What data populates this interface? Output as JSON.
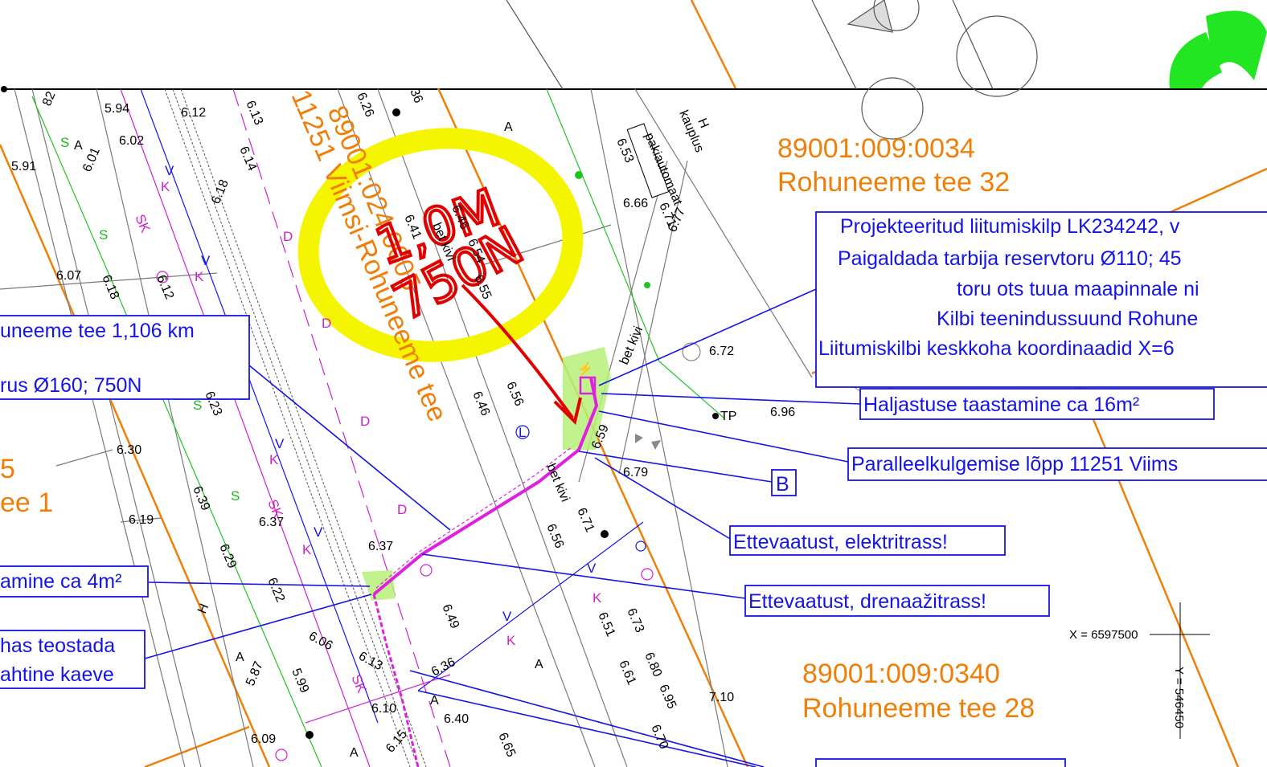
{
  "parcels": [
    {
      "id": "89001:009:0034",
      "name": "Rohuneeme tee 32"
    },
    {
      "id": "89001:009:0340",
      "name": "Rohuneeme tee 28"
    },
    {
      "id": "89001:024:0005",
      "name": "11251 Viimsi-Rohuneeme tee"
    },
    {
      "id": "5",
      "name": "ee 1"
    }
  ],
  "callouts": {
    "project_box": [
      "Projekteeritud liitumiskilp LK234242, v",
      "Paigaldada tarbija reservtoru Ø110; 45",
      "toru ots tuua maapinnale ni",
      "Kilbi teenindussuund Rohune",
      "Liitumiskilbi keskkoha koordinaadid X=6"
    ],
    "left_box_top": [
      "uneeme tee 1,106 km",
      "rus Ø160; 750N"
    ],
    "haljastus": "Haljastuse taastamine ca 16m²",
    "paralleel": "Paralleelkulgemise lõpp 11251 Viims",
    "b_label": "B",
    "elektritrass": "Ettevaatust, elektritrass!",
    "drenaaz": "Ettevaatust, drenaažitrass!",
    "left_box_mid": "amine ca 4m²",
    "left_box_bottom": [
      "has teostada",
      "ahtine kaeve"
    ]
  },
  "handwriting": {
    "line1": "1,0M",
    "line2": "750N"
  },
  "coordinates": {
    "x_label": "X = 6597500",
    "y_label": "Y = 546450"
  },
  "map_text": {
    "h1": "H",
    "h2": "H",
    "kauplus": "kauplus",
    "pakiautomaat": "pakiautomaat",
    "tp": "TP",
    "bet_kivi": "bet kivi",
    "a": "A",
    "s": "S",
    "v": "V",
    "k": "K",
    "sk": "SK",
    "d": "D",
    "l": "L"
  },
  "elevations": [
    "5.94",
    "6.12",
    "6.13",
    "6.02",
    "6.01",
    "5.91",
    "6.18",
    "6.14",
    "6.07",
    "6.18",
    "6.12",
    "6.26",
    "6.41",
    "6.46",
    "6.54",
    "6.55",
    "6.53",
    "6.66",
    "6.71",
    "6.77",
    "6.72",
    "6.96",
    "6.56",
    "6.46",
    "6.59",
    "6.79",
    "6.30",
    "6.23",
    "6.19",
    "6.39",
    "6.37",
    "6.29",
    "6.37",
    "6.22",
    "6.06",
    "6.13",
    "5.87",
    "5.99",
    "6.10",
    "6.36",
    "6.49",
    "6.40",
    "6.15",
    "6.09",
    "6.65",
    "6.56",
    "6.71",
    "6.51",
    "6.73",
    "6.80",
    "6.95",
    "6.61",
    "6.70",
    "7.10",
    "82",
    "36"
  ],
  "colors": {
    "parcel_text": "#f07f0a",
    "callout_blue": "#1414e6",
    "handwriting_red": "#e00000",
    "highlight_yellow": "#f5f500",
    "cable_magenta": "#e020e0",
    "green_area": "#b7f07a"
  }
}
